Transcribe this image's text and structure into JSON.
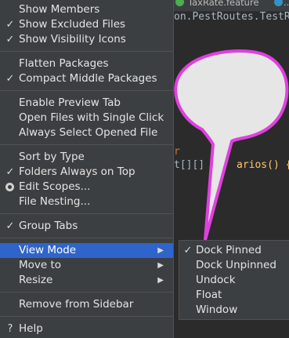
{
  "editor": {
    "tabs": [
      {
        "label": "TaxRate.feature"
      },
      {
        "label": "..."
      }
    ],
    "code_lines": [
      {
        "text": "on.PestRoutes.TestR"
      },
      {
        "text": "r"
      },
      {
        "text": "t[][]"
      },
      {
        "text": "arios() {"
      }
    ]
  },
  "menu": {
    "items": [
      {
        "label": "Show Members",
        "checked": false
      },
      {
        "label": "Show Excluded Files",
        "checked": true
      },
      {
        "label": "Show Visibility Icons",
        "checked": true
      },
      {
        "label": "Flatten Packages",
        "checked": false
      },
      {
        "label": "Compact Middle Packages",
        "checked": true
      },
      {
        "label": "Enable Preview Tab",
        "checked": false
      },
      {
        "label": "Open Files with Single Click",
        "checked": false
      },
      {
        "label": "Always Select Opened File",
        "checked": false
      },
      {
        "label": "Sort by Type",
        "checked": false
      },
      {
        "label": "Folders Always on Top",
        "checked": true
      },
      {
        "label": "Edit Scopes...",
        "radio": true
      },
      {
        "label": "File Nesting...",
        "checked": false
      },
      {
        "label": "Group Tabs",
        "checked": true
      },
      {
        "label": "View Mode",
        "submenu": true,
        "active": true
      },
      {
        "label": "Move to",
        "submenu": true
      },
      {
        "label": "Resize",
        "submenu": true
      },
      {
        "label": "Remove from Sidebar"
      },
      {
        "label": "Help",
        "icon": "help-icon",
        "glyph": "?"
      }
    ],
    "checkmark_glyph": "✓",
    "arrow_glyph": "▶"
  },
  "submenu": {
    "items": [
      {
        "label": "Dock Pinned",
        "checked": true
      },
      {
        "label": "Dock Unpinned",
        "checked": false
      },
      {
        "label": "Undock",
        "checked": false
      },
      {
        "label": "Float",
        "checked": false
      },
      {
        "label": "Window",
        "checked": false
      }
    ]
  },
  "colors": {
    "menu_bg": "#3c3f41",
    "highlight": "#2f65ca",
    "editor_bg": "#2b2b2b",
    "bubble_stroke": "#e040e0",
    "bubble_fill": "#e6e6e6"
  }
}
